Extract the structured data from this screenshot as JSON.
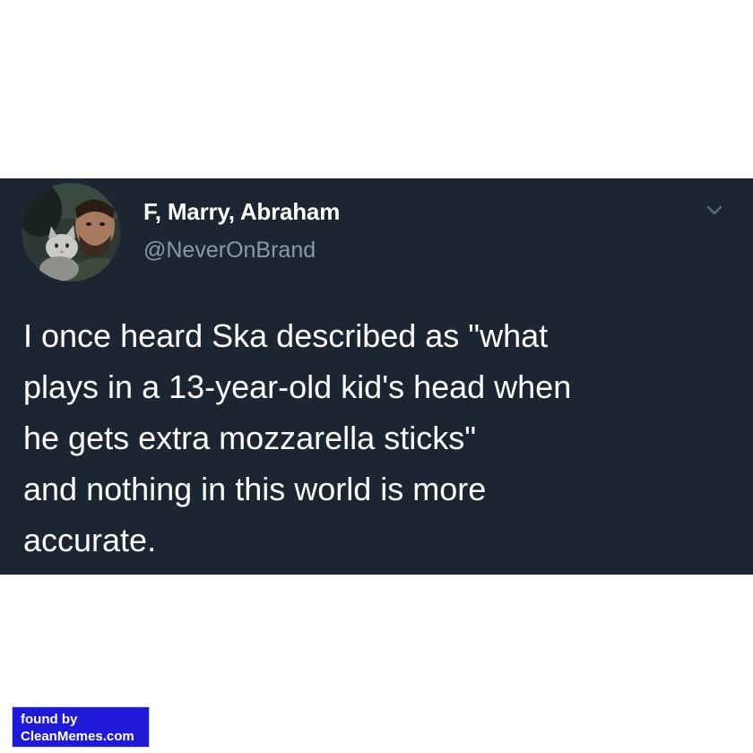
{
  "tweet": {
    "author": {
      "display_name": "F, Marry, Abraham",
      "handle": "@NeverOnBrand",
      "avatar": "avatar-photo-man-with-cat"
    },
    "menu_icon": "chevron-down-icon",
    "text_lines": [
      "I once heard Ska described as \"what",
      "plays in a 13-year-old kid's head when",
      "he gets extra mozzarella sticks\"",
      "and nothing in this world is more",
      "accurate."
    ]
  },
  "watermark": {
    "line1": "found by",
    "line2": "CleanMemes.com"
  },
  "colors": {
    "card_background": "#1c2532",
    "handle_text": "#8a99aa",
    "watermark_background": "#1f1ad8"
  }
}
